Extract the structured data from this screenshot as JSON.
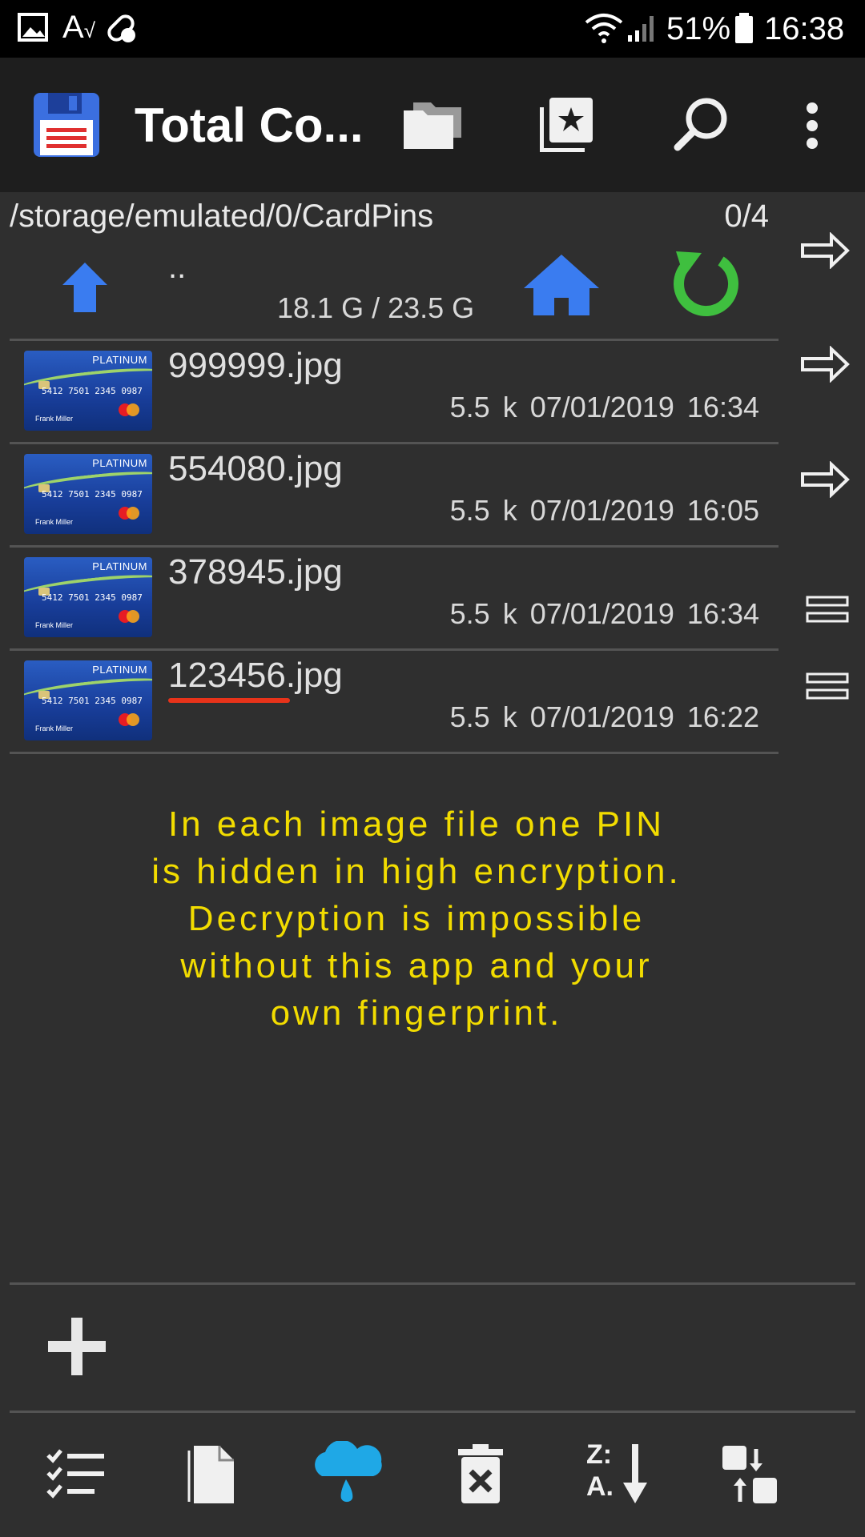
{
  "status_bar": {
    "battery": "51%",
    "time": "16:38"
  },
  "app": {
    "title": "Total Co..."
  },
  "panel": {
    "path": "/storage/emulated/0/CardPins",
    "count": "0/4",
    "parent": "..",
    "space": "18.1 G / 23.5 G"
  },
  "files": [
    {
      "name": "999999.jpg",
      "size": "5.5 k",
      "date": "07/01/2019",
      "time": "16:34"
    },
    {
      "name": "554080.jpg",
      "size": "5.5 k",
      "date": "07/01/2019",
      "time": "16:05"
    },
    {
      "name": "378945.jpg",
      "size": "5.5 k",
      "date": "07/01/2019",
      "time": "16:34"
    },
    {
      "name": "123456.jpg",
      "size": "5.5 k",
      "date": "07/01/2019",
      "time": "16:22"
    }
  ],
  "thumbnail": {
    "brand": "PLATINUM",
    "number": "5412 7501 2345 0987",
    "holder": "Frank Miller"
  },
  "info_lines": [
    "In each image file one PIN",
    "is hidden in high encryption.",
    "Decryption is impossible",
    "without this app and your",
    "own fingerprint."
  ],
  "icons": {
    "status": [
      "image-icon",
      "text-style-icon",
      "pill-icon",
      "wifi-icon",
      "signal-icon",
      "battery-icon"
    ],
    "appbar": [
      "floppy-disk-icon",
      "folders-icon",
      "bookmark-star-icon",
      "search-icon",
      "more-vert-icon"
    ],
    "panel": [
      "up-arrow-icon",
      "home-icon",
      "refresh-icon"
    ],
    "side": [
      "arrow-right-icon",
      "arrow-right-icon",
      "arrow-right-icon",
      "equals-icon",
      "equals-icon"
    ],
    "bottom": [
      "checklist-icon",
      "file-icon",
      "cloud-rain-icon",
      "delete-icon",
      "sort-za-icon",
      "swap-icon"
    ]
  },
  "colors": {
    "background": "#2f2f2f",
    "appbar": "#1e1e1e",
    "info_text": "#f2dc00",
    "accent_blue": "#3a7cf0",
    "refresh_green": "#3fbf3f",
    "underline_red": "#e8331a"
  }
}
